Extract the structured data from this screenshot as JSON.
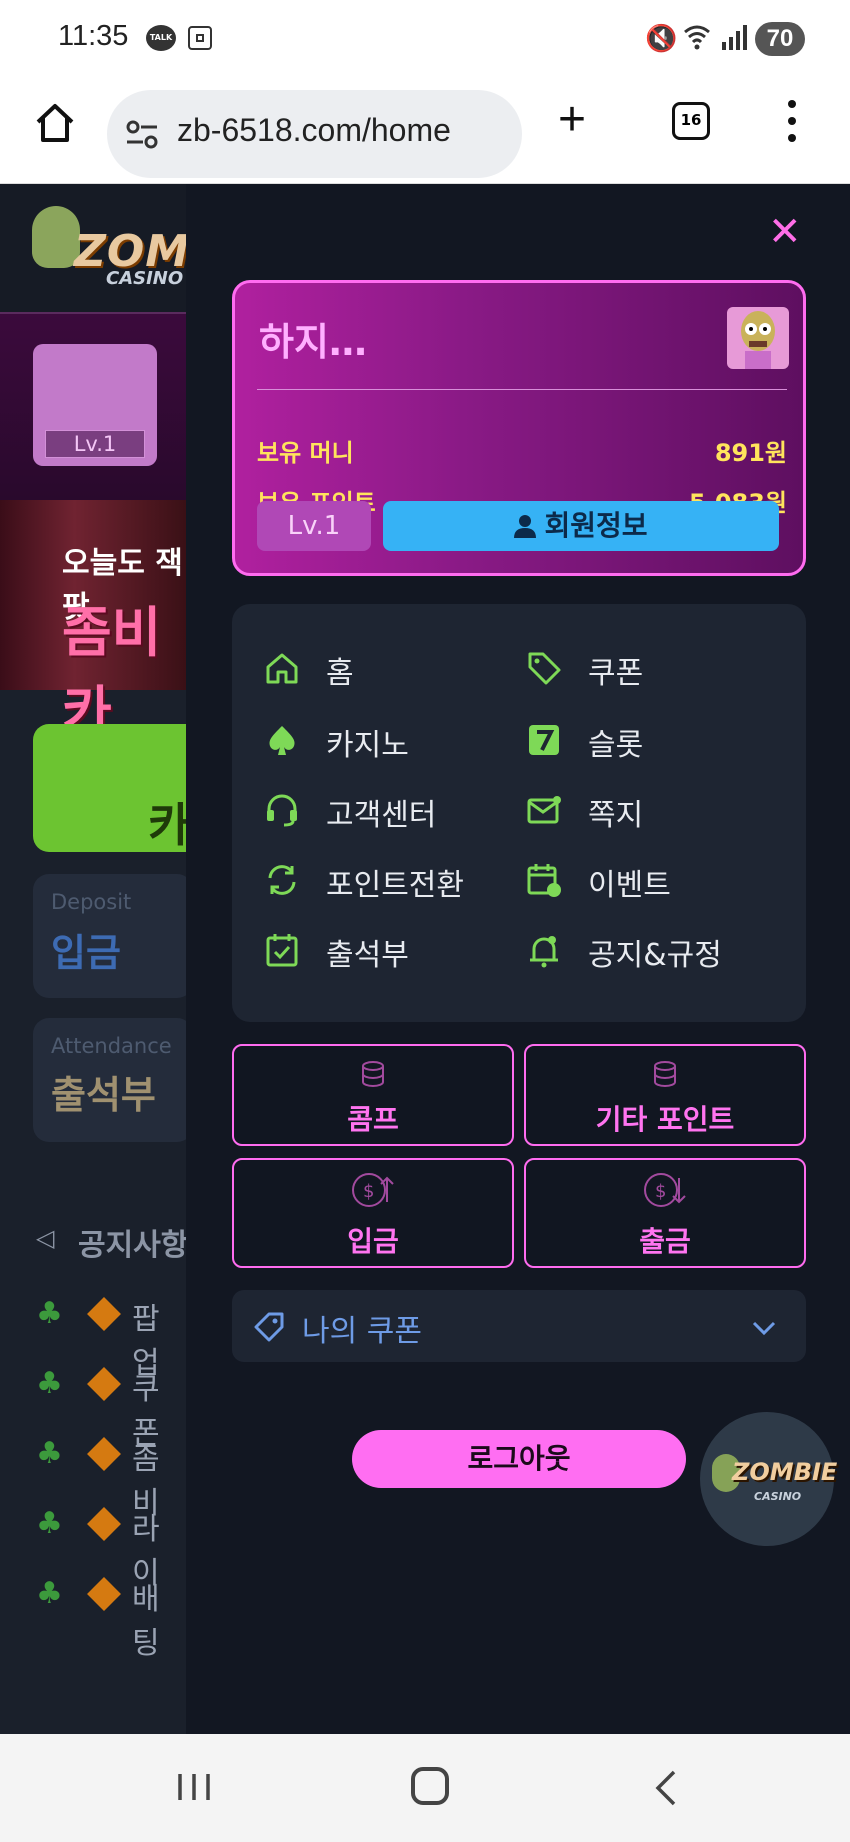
{
  "status_bar": {
    "time": "11:35",
    "talk_badge": "TALK",
    "battery": "70"
  },
  "browser": {
    "url": "zb-6518.com/home",
    "tab_count": "16"
  },
  "site": {
    "logo_main": "ZOMBIE",
    "logo_sub": "CASINO",
    "level_badge": "Lv.1",
    "banner_line1": "오늘도 잭팟",
    "banner_line2": "좀비카",
    "green_button_text": "카",
    "deposit_card": {
      "subtitle": "Deposit",
      "title": "입금"
    },
    "attendance_card": {
      "subtitle": "Attendance",
      "title": "출석부"
    },
    "notice_title": "공지사항",
    "notices": [
      "팝업",
      "쿠폰",
      "좀비",
      "라이",
      "배팅"
    ],
    "bottom_nav_label": "입금",
    "bottom_nav_coin": "$"
  },
  "drawer": {
    "close_symbol": "✕",
    "profile": {
      "name": "하지…",
      "money_label": "보유 머니",
      "money_value": "891원",
      "points_label": "보유 포인트",
      "points_value": "5,083원",
      "level": "Lv.1",
      "member_info_button": "회원정보"
    },
    "menu": [
      {
        "label": "홈",
        "icon": "home-icon"
      },
      {
        "label": "쿠폰",
        "icon": "tag-icon"
      },
      {
        "label": "카지노",
        "icon": "spade-icon"
      },
      {
        "label": "슬롯",
        "icon": "seven-icon"
      },
      {
        "label": "고객센터",
        "icon": "headset-icon"
      },
      {
        "label": "쪽지",
        "icon": "mail-icon"
      },
      {
        "label": "포인트전환",
        "icon": "refresh-icon"
      },
      {
        "label": "이벤트",
        "icon": "calendar-icon"
      },
      {
        "label": "출석부",
        "icon": "check-calendar-icon"
      },
      {
        "label": "공지&규정",
        "icon": "bell-icon"
      }
    ],
    "point_buttons": {
      "comp": "콤프",
      "other_points": "기타 포인트",
      "deposit": "입금",
      "withdraw": "출금"
    },
    "coupon_dropdown": "나의 쿠폰",
    "logout": "로그아웃",
    "fab_logo": "ZOMBIE",
    "fab_sub": "CASINO"
  },
  "colors": {
    "accent_pink": "#ff6cf0",
    "accent_green": "#7ed957",
    "info_blue": "#36b2f5",
    "money_yellow": "#ffe45c"
  }
}
